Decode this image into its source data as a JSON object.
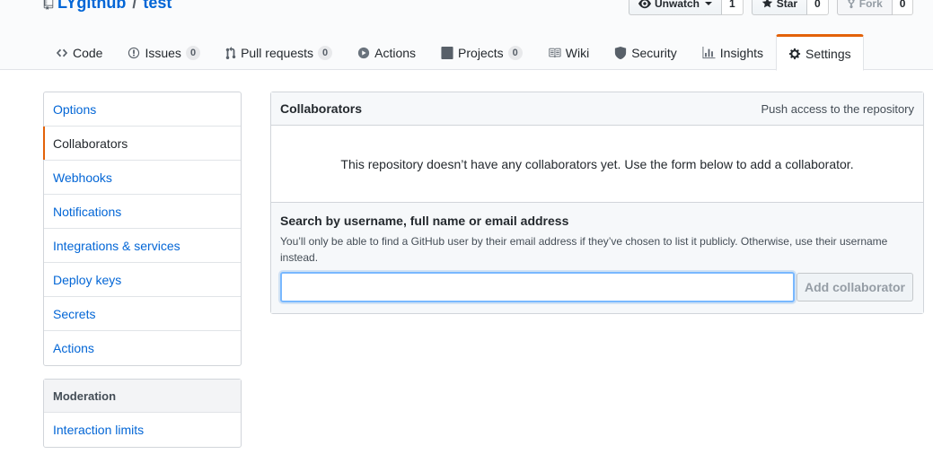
{
  "header": {
    "owner": "LYgithub",
    "separator": "/",
    "repo": "test",
    "watch_label": "Unwatch",
    "watch_count": "1",
    "star_label": "Star",
    "star_count": "0",
    "fork_label": "Fork",
    "fork_count": "0"
  },
  "nav": {
    "code": "Code",
    "issues": "Issues",
    "issues_count": "0",
    "pulls": "Pull requests",
    "pulls_count": "0",
    "actions": "Actions",
    "projects": "Projects",
    "projects_count": "0",
    "wiki": "Wiki",
    "security": "Security",
    "insights": "Insights",
    "settings": "Settings"
  },
  "sidebar": {
    "items": [
      "Options",
      "Collaborators",
      "Webhooks",
      "Notifications",
      "Integrations & services",
      "Deploy keys",
      "Secrets",
      "Actions"
    ],
    "selected": "Collaborators",
    "moderation_heading": "Moderation",
    "moderation_items": [
      "Interaction limits"
    ]
  },
  "collaborators": {
    "title": "Collaborators",
    "note": "Push access to the repository",
    "blank": "This repository doesn’t have any collaborators yet. Use the form below to add a collaborator.",
    "search_label": "Search by username, full name or email address",
    "search_note": "You’ll only be able to find a GitHub user by their email address if they’ve chosen to list it publicly. Otherwise, use their username instead.",
    "search_value": "",
    "add_button": "Add collaborator"
  },
  "colors": {
    "link": "#0366d6",
    "accent_orange": "#e36209",
    "focus_blue": "#79b8ff"
  }
}
